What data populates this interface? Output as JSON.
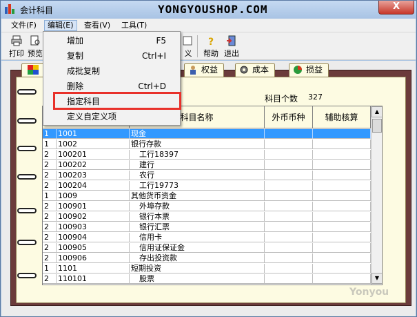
{
  "window": {
    "title": "会计科目",
    "watermark_top": "YONGYOUSHOP.COM",
    "close_glyph": "X",
    "watermark_bottom": "Yonyou"
  },
  "menubar": {
    "items": [
      {
        "label": "文件(F)"
      },
      {
        "label": "编辑(E)"
      },
      {
        "label": "查看(V)"
      },
      {
        "label": "工具(T)"
      }
    ]
  },
  "toolbar": {
    "print": "打印",
    "preview": "预览",
    "define_suffix": "义",
    "help": "帮助",
    "exit": "退出"
  },
  "edit_menu": {
    "items": [
      {
        "label": "增加",
        "shortcut": "F5"
      },
      {
        "label": "复制",
        "shortcut": "Ctrl+I"
      },
      {
        "label": "成批复制",
        "shortcut": ""
      },
      {
        "label": "删除",
        "shortcut": "Ctrl+D"
      },
      {
        "label": "指定科目",
        "shortcut": ""
      },
      {
        "label": "定义自定义项",
        "shortcut": ""
      }
    ]
  },
  "tabs": {
    "equity": "权益",
    "cost": "成本",
    "pl": "损益"
  },
  "summary": {
    "count_label": "科目个数",
    "count_value": "327"
  },
  "grid": {
    "headers": {
      "name": "科目名称",
      "currency": "外币币种",
      "aux": "辅助核算"
    },
    "rows": [
      {
        "level": "1",
        "code": "1001",
        "name": "现金"
      },
      {
        "level": "1",
        "code": "1002",
        "name": "银行存款"
      },
      {
        "level": "2",
        "code": "100201",
        "name": "工行18397"
      },
      {
        "level": "2",
        "code": "100202",
        "name": "建行"
      },
      {
        "level": "2",
        "code": "100203",
        "name": "农行"
      },
      {
        "level": "2",
        "code": "100204",
        "name": "工行19773"
      },
      {
        "level": "1",
        "code": "1009",
        "name": "其他货币资金"
      },
      {
        "level": "2",
        "code": "100901",
        "name": "外埠存款"
      },
      {
        "level": "2",
        "code": "100902",
        "name": "银行本票"
      },
      {
        "level": "2",
        "code": "100903",
        "name": "银行汇票"
      },
      {
        "level": "2",
        "code": "100904",
        "name": "信用卡"
      },
      {
        "level": "2",
        "code": "100905",
        "name": "信用证保证金"
      },
      {
        "level": "2",
        "code": "100906",
        "name": "存出投资款"
      },
      {
        "level": "1",
        "code": "1101",
        "name": "短期投资"
      },
      {
        "level": "2",
        "code": "110101",
        "name": "股票"
      }
    ]
  },
  "colors": {
    "selection": "#3399ff",
    "highlight_box": "#e8312a",
    "notebook": "#fdfbe2",
    "binding": "#6b3b3b"
  }
}
